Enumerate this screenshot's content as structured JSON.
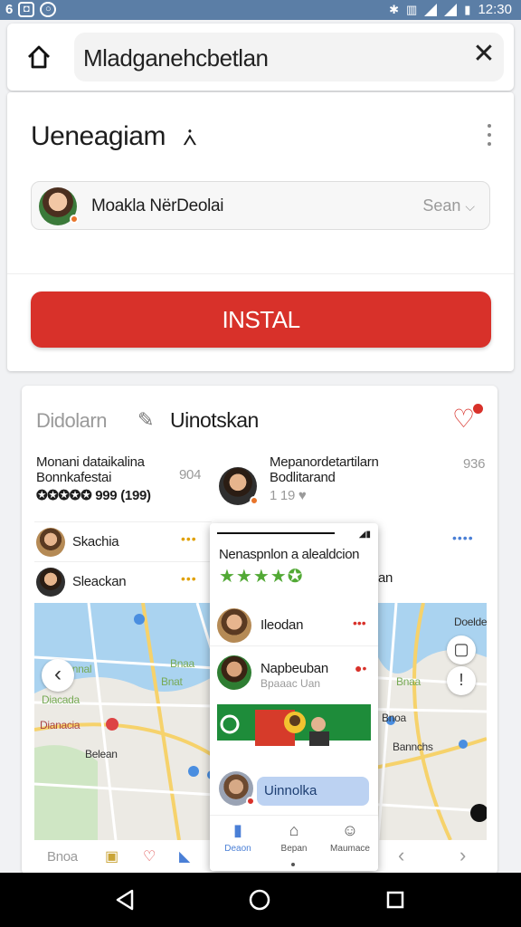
{
  "status_bar": {
    "left_icons": [
      "b-icon",
      "image-icon",
      "circle-icon"
    ],
    "left_text": "6",
    "time": "12:30"
  },
  "top_bar": {
    "url": "Mladganehcbetlan"
  },
  "app": {
    "title": "Ueneagiam",
    "title_icon": "person-icon",
    "account": {
      "name": "Moakla NërDeolai",
      "action": "Sean"
    },
    "install_label": "INSTAL",
    "accent_color": "#d8312a"
  },
  "listing": {
    "tab_inactive": "Didolarn",
    "tab_active": "Uinotskan",
    "item_left": {
      "line1": "Monani dataikalina",
      "line2": "Bonnkafestai",
      "rating_text": "999 (199)",
      "count": "904"
    },
    "item_right": {
      "line1": "Mepanordetartilarn",
      "line2": "Bodlitarand",
      "likes": "1 19",
      "count": "936"
    },
    "people": [
      {
        "name": "Skachia"
      },
      {
        "name": "Sleackan"
      }
    ],
    "right_partial_text": "an",
    "map_labels": [
      "Bnnal",
      "Bnat",
      "Dianacia",
      "Belean",
      "Bnoa",
      "Doelde",
      "Diacada",
      "Bannchs",
      "Bnaa",
      "Bnaa"
    ],
    "bottom_nav": [
      "Bnoa",
      "",
      "",
      "",
      ""
    ]
  },
  "overlay": {
    "title": "Nenaspnlon a alealdcion",
    "stars": "★★★★✪",
    "rows": [
      {
        "name": "Ileodan"
      },
      {
        "name": "Napbeuban",
        "sub": "Bpaaac Uan"
      }
    ],
    "pill": "Uinnolka",
    "nav": [
      {
        "label": "Deaon",
        "icon": "home-icon"
      },
      {
        "label": "Bepan",
        "icon": "bank-icon"
      },
      {
        "label": "Maumace",
        "icon": "profile-icon"
      }
    ]
  }
}
